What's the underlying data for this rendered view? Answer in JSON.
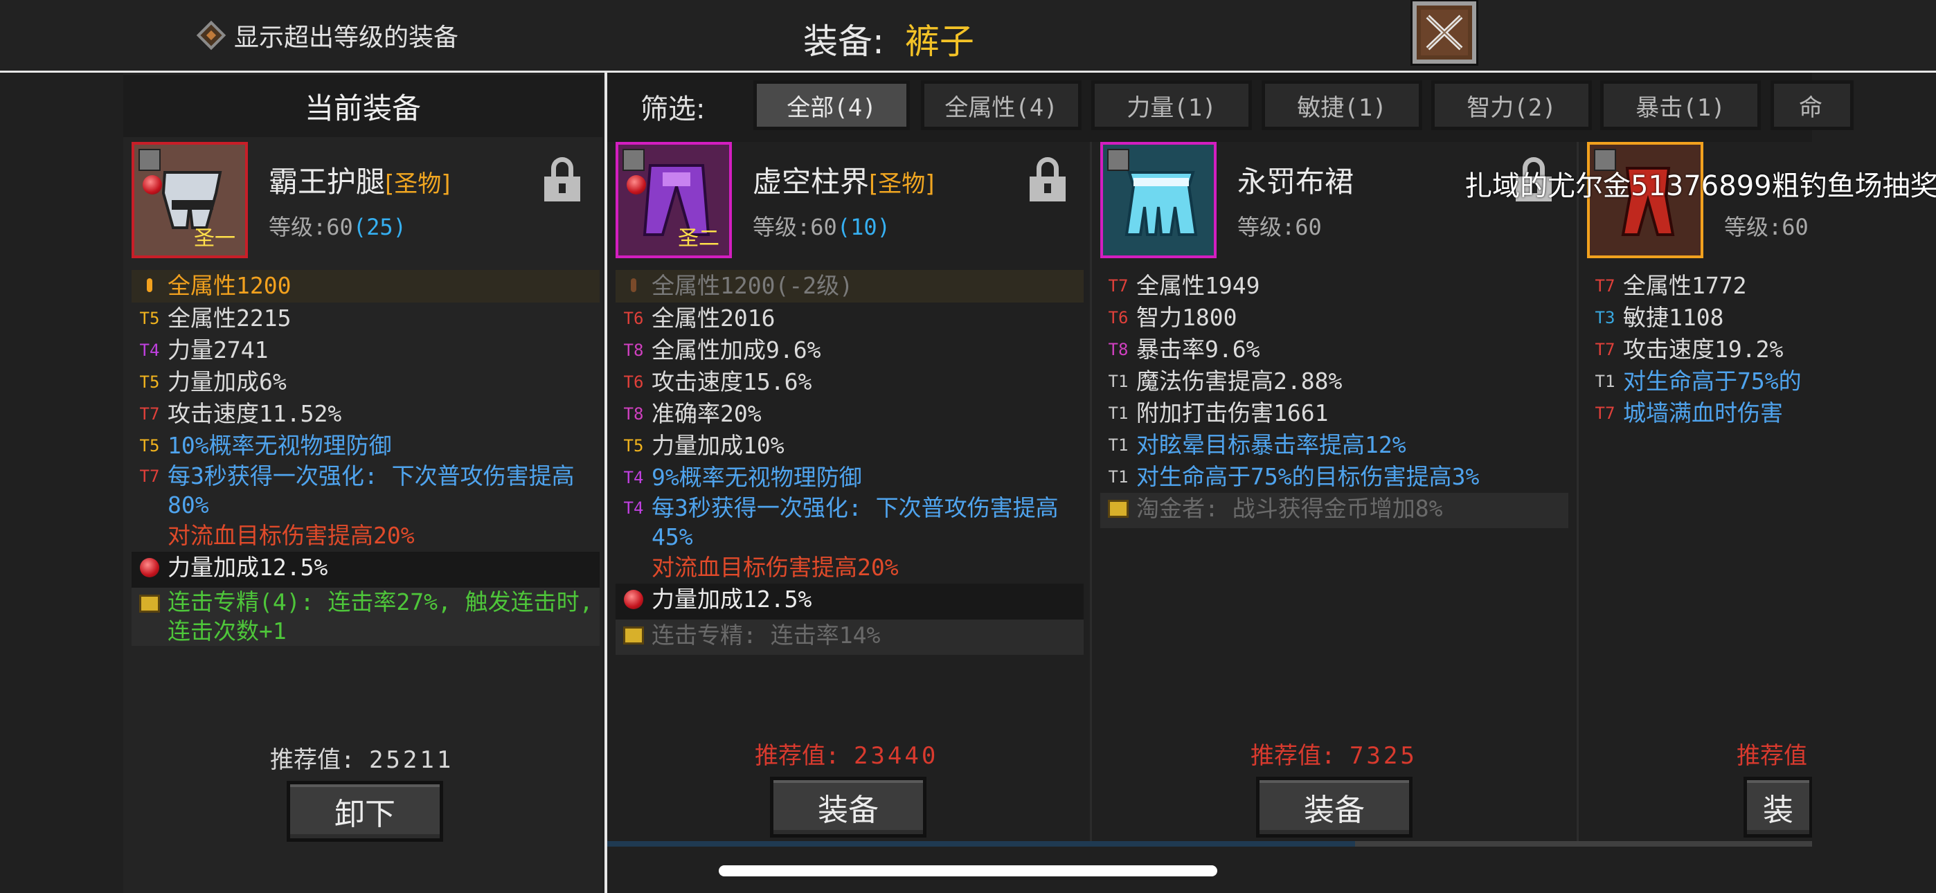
{
  "top": {
    "toggle_label": "显示超出等级的装备",
    "title_label": "装备:",
    "title_value": "裤子"
  },
  "left_panel": {
    "header": "当前装备"
  },
  "filter": {
    "label": "筛选:",
    "tabs": [
      "全部(4)",
      "全属性(4)",
      "力量(1)",
      "敏捷(1)",
      "智力(2)",
      "暴击(1)",
      "命"
    ]
  },
  "cards": [
    {
      "name": "霸王护腿",
      "holy": "[圣物]",
      "level_label": "等级:60",
      "level_extra": "(25)",
      "tag": "圣一",
      "border_color": "#c81e28",
      "icon_bg": "#6a4a40",
      "stats": [
        {
          "tier": "",
          "text": "全属性1200",
          "color": "#f2a11e",
          "tier_color": "#f2a11e",
          "row": "highlight"
        },
        {
          "tier": "T5",
          "text": "全属性2215",
          "color": "#dcdcdc",
          "tier_color": "#f2b41e"
        },
        {
          "tier": "T4",
          "text": "力量2741",
          "color": "#dcdcdc",
          "tier_color": "#c040e0"
        },
        {
          "tier": "T5",
          "text": "力量加成6%",
          "color": "#dcdcdc",
          "tier_color": "#f2b41e"
        },
        {
          "tier": "T7",
          "text": "攻击速度11.52%",
          "color": "#dcdcdc",
          "tier_color": "#e0403a"
        },
        {
          "tier": "T5",
          "text": "10%概率无视物理防御",
          "color": "#4fa4ee",
          "tier_color": "#f2b41e"
        },
        {
          "tier": "T7",
          "text": "每3秒获得一次强化: 下次普攻伤害提高80%",
          "color": "#4fa4ee",
          "tier_color": "#e0403a",
          "wrap": true
        },
        {
          "tier": "",
          "text": "对流血目标伤害提高20%",
          "color": "#e04a2a",
          "tier_color": "#e04a2a"
        },
        {
          "tier": "gem",
          "text": "力量加成12.5%",
          "color": "#ececec",
          "row": "gem"
        },
        {
          "tier": "book",
          "text": "连击专精(4): 连击率27%, 触发连击时, 连击次数+1",
          "color": "#4ec63a",
          "row": "book",
          "wrap": true
        }
      ],
      "rec_label": "推荐值:",
      "rec_value": "25211",
      "rec_color": "#d8d8d8",
      "button": "卸下"
    },
    {
      "name": "虚空柱界",
      "holy": "[圣物]",
      "level_label": "等级:60",
      "level_extra": "(10)",
      "tag": "圣二",
      "border_color": "#d31ec0",
      "icon_bg": "#55204f",
      "stats": [
        {
          "tier": "",
          "text": "全属性1200(-2级)",
          "color": "#7a7a7a",
          "tier_color": "#7a4a2a",
          "row": "highlight"
        },
        {
          "tier": "T6",
          "text": "全属性2016",
          "color": "#dcdcdc",
          "tier_color": "#e0403a"
        },
        {
          "tier": "T8",
          "text": "全属性加成9.6%",
          "color": "#dcdcdc",
          "tier_color": "#d040c0"
        },
        {
          "tier": "T6",
          "text": "攻击速度15.6%",
          "color": "#dcdcdc",
          "tier_color": "#e0403a"
        },
        {
          "tier": "T8",
          "text": "准确率20%",
          "color": "#dcdcdc",
          "tier_color": "#d040c0"
        },
        {
          "tier": "T5",
          "text": "力量加成10%",
          "color": "#dcdcdc",
          "tier_color": "#f2b41e"
        },
        {
          "tier": "T4",
          "text": "9%概率无视物理防御",
          "color": "#4fa4ee",
          "tier_color": "#c040e0"
        },
        {
          "tier": "T4",
          "text": "每3秒获得一次强化: 下次普攻伤害提高45%",
          "color": "#4fa4ee",
          "tier_color": "#c040e0",
          "wrap": true
        },
        {
          "tier": "",
          "text": "对流血目标伤害提高20%",
          "color": "#e04a2a",
          "tier_color": "#e04a2a"
        },
        {
          "tier": "gem",
          "text": "力量加成12.5%",
          "color": "#ececec",
          "row": "gem"
        },
        {
          "tier": "book",
          "text": "连击专精: 连击率14%",
          "color": "#6a6a6a",
          "row": "book"
        }
      ],
      "rec_label": "推荐值:",
      "rec_value": "23440",
      "rec_color": "#d83a2e",
      "button": "装备"
    },
    {
      "name": "永罚布裙",
      "holy": "",
      "level_label": "等级:60",
      "level_extra": "",
      "tag": "",
      "border_color": "#d31ec0",
      "icon_bg": "#1e4a58",
      "stats": [
        {
          "tier": "T7",
          "text": "全属性1949",
          "color": "#dcdcdc",
          "tier_color": "#e0403a"
        },
        {
          "tier": "T6",
          "text": "智力1800",
          "color": "#dcdcdc",
          "tier_color": "#e0403a"
        },
        {
          "tier": "T8",
          "text": "暴击率9.6%",
          "color": "#dcdcdc",
          "tier_color": "#d040c0"
        },
        {
          "tier": "T1",
          "text": "魔法伤害提高2.88%",
          "color": "#dcdcdc",
          "tier_color": "#c8c8c8"
        },
        {
          "tier": "T1",
          "text": "附加打击伤害1661",
          "color": "#dcdcdc",
          "tier_color": "#c8c8c8"
        },
        {
          "tier": "T1",
          "text": "对眩晕目标暴击率提高12%",
          "color": "#4fa4ee",
          "tier_color": "#c8c8c8"
        },
        {
          "tier": "T1",
          "text": "对生命高于75%的目标伤害提高3%",
          "color": "#4fa4ee",
          "tier_color": "#c8c8c8"
        },
        {
          "tier": "book",
          "text": "淘金者: 战斗获得金币增加8%",
          "color": "#6a6a6a",
          "row": "book"
        }
      ],
      "rec_label": "推荐值:",
      "rec_value": "7325",
      "rec_color": "#d83a2e",
      "button": "装备"
    },
    {
      "name": "",
      "holy": "",
      "level_label": "等级:60",
      "level_extra": "",
      "tag": "",
      "border_color": "#f2a11e",
      "icon_bg": "#4a2a20",
      "stats": [
        {
          "tier": "T7",
          "text": "全属性1772",
          "color": "#dcdcdc",
          "tier_color": "#e0403a"
        },
        {
          "tier": "T3",
          "text": "敏捷1108",
          "color": "#dcdcdc",
          "tier_color": "#38a8e0"
        },
        {
          "tier": "T7",
          "text": "攻击速度19.2%",
          "color": "#dcdcdc",
          "tier_color": "#e0403a"
        },
        {
          "tier": "T1",
          "text": "对生命高于75%的",
          "color": "#4fa4ee",
          "tier_color": "#c8c8c8"
        },
        {
          "tier": "T7",
          "text": "城墙满血时伤害",
          "color": "#4fa4ee",
          "tier_color": "#e0403a"
        }
      ],
      "rec_label": "推荐值",
      "rec_value": "",
      "rec_color": "#d83a2e",
      "button": "装"
    }
  ],
  "overlay": "扎域的尤尔金51376899粗钓鱼场抽奖"
}
